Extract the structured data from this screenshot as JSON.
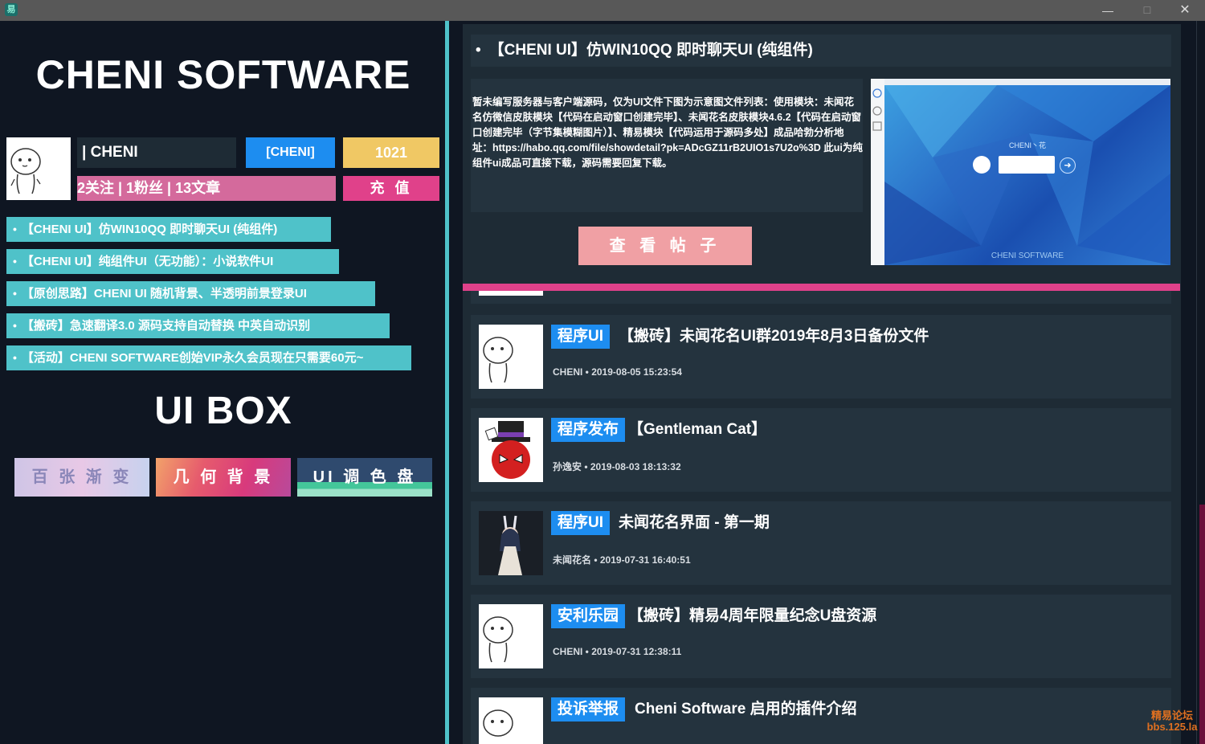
{
  "window": {
    "app_icon": "易",
    "minimize": "—",
    "maximize": "☐",
    "close": "✕"
  },
  "left": {
    "brand_title": "CHENI SOFTWARE",
    "username": "| CHENI",
    "badge_blue": "[CHENI]",
    "badge_yellow": "1021",
    "stats": "2关注 | 1粉丝 | 13文章",
    "recharge": "充 值",
    "posts": [
      "【CHENI UI】仿WIN10QQ 即时聊天UI (纯组件)",
      "【CHENI UI】纯组件UI（无功能）：小说软件UI",
      "【原创思路】CHENI UI 随机背景、半透明前景登录UI",
      "【搬砖】急速翻译3.0 源码支持自动替换 中英自动识别",
      "【活动】CHENI SOFTWARE创始VIP永久会员现在只需要60元~"
    ],
    "uibox_title": "UI BOX",
    "theme_buttons": [
      "百 张 渐 变",
      "几 何 背 景",
      "UI 调 色 盘"
    ]
  },
  "hero": {
    "title": "【CHENI UI】仿WIN10QQ 即时聊天UI (纯组件)",
    "description": "暂未编写服务器与客户端源码，仅为UI文件下图为示意图文件列表：使用模块：未闻花名仿微信皮肤模块【代码在启动窗口创建完毕】、未闻花名皮肤模块4.6.2【代码在启动窗口创建完毕（字节集模糊图片）】、精易模块【代码运用于源码多处】成品哈勃分析地址：https://habo.qq.com/file/showdetail?pk=ADcGZ11rB2UIO1s7U2o%3D 此ui为纯组件ui成品可直接下载，源码需要回复下载。",
    "view_button": "查 看 帖 子",
    "image_login_title": "CHENI丶花",
    "image_go_arrow": "➜",
    "image_brand": "CHENI SOFTWARE"
  },
  "cards": [
    {
      "tag": "程序UI",
      "title": "【搬砖】未闻花名UI群2019年8月3日备份文件",
      "meta": "CHENI • 2019-08-05 15:23:54",
      "avatar": "cartoon-avatar-icon"
    },
    {
      "tag": "程序发布",
      "title": "【Gentleman Cat】",
      "meta": "孙逸安 • 2019-08-03 18:13:32",
      "avatar": "spider-hat-avatar-icon"
    },
    {
      "tag": "程序UI",
      "title": "未闻花名界面 - 第一期",
      "meta": "未闻花名 • 2019-07-31 16:40:51",
      "avatar": "anime-girl-avatar-icon"
    },
    {
      "tag": "安利乐园",
      "title": "【搬砖】精易4周年限量纪念U盘资源",
      "meta": "CHENI • 2019-07-31 12:38:11",
      "avatar": "cartoon-avatar-icon"
    },
    {
      "tag": "投诉举报",
      "title": "Cheni Software 启用的插件介绍",
      "meta": "",
      "avatar": "cartoon-avatar-icon"
    }
  ],
  "watermark": {
    "line1": "精易论坛",
    "line2": "bbs.125.la"
  },
  "colors": {
    "accent_cyan": "#4fc2c9",
    "accent_blue": "#1d8df0",
    "accent_pink": "#e0418a",
    "accent_yellow": "#f0c864",
    "panel": "#24333e",
    "background": "#0f1622"
  }
}
